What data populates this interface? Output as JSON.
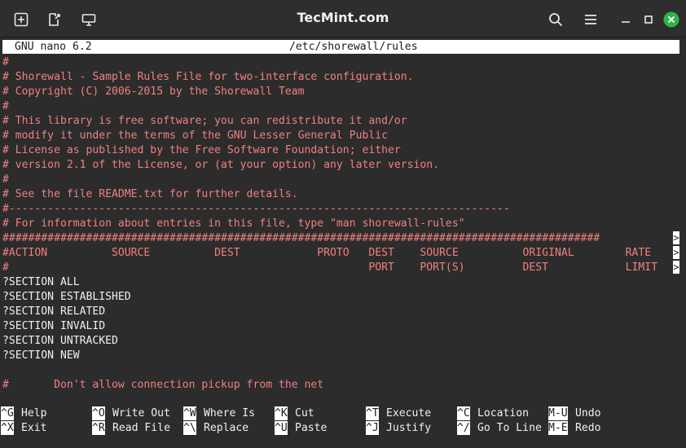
{
  "window": {
    "title": "TecMint.com",
    "icons": [
      "new-tab-icon",
      "file-export-icon",
      "terminal-cast-icon",
      "search-icon",
      "menu-icon",
      "minimize-icon",
      "maximize-icon",
      "close-icon"
    ]
  },
  "nano": {
    "version": "GNU nano 6.2",
    "filename": "/etc/shorewall/rules"
  },
  "content": {
    "lines": [
      "#",
      "# Shorewall - Sample Rules File for two-interface configuration.",
      "# Copyright (C) 2006-2015 by the Shorewall Team",
      "#",
      "# This library is free software; you can redistribute it and/or",
      "# modify it under the terms of the GNU Lesser General Public",
      "# License as published by the Free Software Foundation; either",
      "# version 2.1 of the License, or (at your option) any later version.",
      "#",
      "# See the file README.txt for further details.",
      "#------------------------------------------------------------------------------",
      "# For information about entries in this file, type \"man shorewall-rules\"",
      "#############################################################################################",
      "#ACTION          SOURCE          DEST            PROTO   DEST    SOURCE          ORIGINAL        RATE",
      "#                                                        PORT    PORT(S)         DEST            LIMIT",
      "?SECTION ALL",
      "?SECTION ESTABLISHED",
      "?SECTION RELATED",
      "?SECTION INVALID",
      "?SECTION UNTRACKED",
      "?SECTION NEW",
      "",
      "#       Don't allow connection pickup from the net"
    ],
    "overflow_marker": ">"
  },
  "shortcuts": {
    "row1": [
      {
        "key": "^G",
        "label": "Help"
      },
      {
        "key": "^O",
        "label": "Write Out"
      },
      {
        "key": "^W",
        "label": "Where Is"
      },
      {
        "key": "^K",
        "label": "Cut"
      },
      {
        "key": "^T",
        "label": "Execute"
      },
      {
        "key": "^C",
        "label": "Location"
      },
      {
        "key": "M-U",
        "label": "Undo"
      }
    ],
    "row2": [
      {
        "key": "^X",
        "label": "Exit"
      },
      {
        "key": "^R",
        "label": "Read File"
      },
      {
        "key": "^\\",
        "label": "Replace"
      },
      {
        "key": "^U",
        "label": "Paste"
      },
      {
        "key": "^J",
        "label": "Justify"
      },
      {
        "key": "^/",
        "label": "Go To Line"
      },
      {
        "key": "M-E",
        "label": "Redo"
      }
    ]
  },
  "colors": {
    "comment": "#f08080",
    "text": "#f0f0f0",
    "background": "#2c2c2c",
    "close_button": "#2fb34a"
  }
}
